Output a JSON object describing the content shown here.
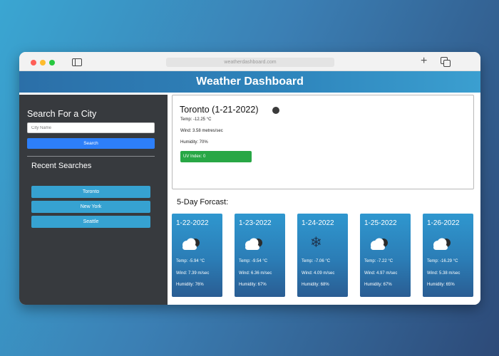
{
  "browser": {
    "url": "weatherdashboard.com"
  },
  "header": {
    "title": "Weather Dashboard"
  },
  "sidebar": {
    "search_title": "Search For a City",
    "search_placeholder": "City Name",
    "search_button": "Search",
    "recent_title": "Recent Searches",
    "recent": [
      "Toronto",
      "New York",
      "Seattle"
    ]
  },
  "current": {
    "city_date": "Toronto (1-21-2022)",
    "temp": "Temp: -12.25 °C",
    "wind": "Wind: 3.58 metres/sec",
    "humidity": "Humidity: 70%",
    "uv": "UV Index: 0",
    "uv_color": "#28a745"
  },
  "forecast": {
    "title": "5-Day Forcast:",
    "days": [
      {
        "date": "1-22-2022",
        "icon": "cloud-icon",
        "temp": "Temp: -5.94 °C",
        "wind": "Wind: 7.39 m/sec",
        "humidity": "Humidity: 76%"
      },
      {
        "date": "1-23-2022",
        "icon": "cloud-icon",
        "temp": "Temp: -9.54 °C",
        "wind": "Wind: 6.36 m/sec",
        "humidity": "Humidity: 67%"
      },
      {
        "date": "1-24-2022",
        "icon": "snowflake-icon",
        "temp": "Temp: -7.06 °C",
        "wind": "Wind: 4.09 m/sec",
        "humidity": "Humidity: 68%"
      },
      {
        "date": "1-25-2022",
        "icon": "cloud-icon",
        "temp": "Temp: -7.22 °C",
        "wind": "Wind: 4.97 m/sec",
        "humidity": "Humidity: 67%"
      },
      {
        "date": "1-26-2022",
        "icon": "cloud-icon",
        "temp": "Temp: -16.29 °C",
        "wind": "Wind: 5.38 m/sec",
        "humidity": "Humidity: 65%"
      }
    ]
  }
}
